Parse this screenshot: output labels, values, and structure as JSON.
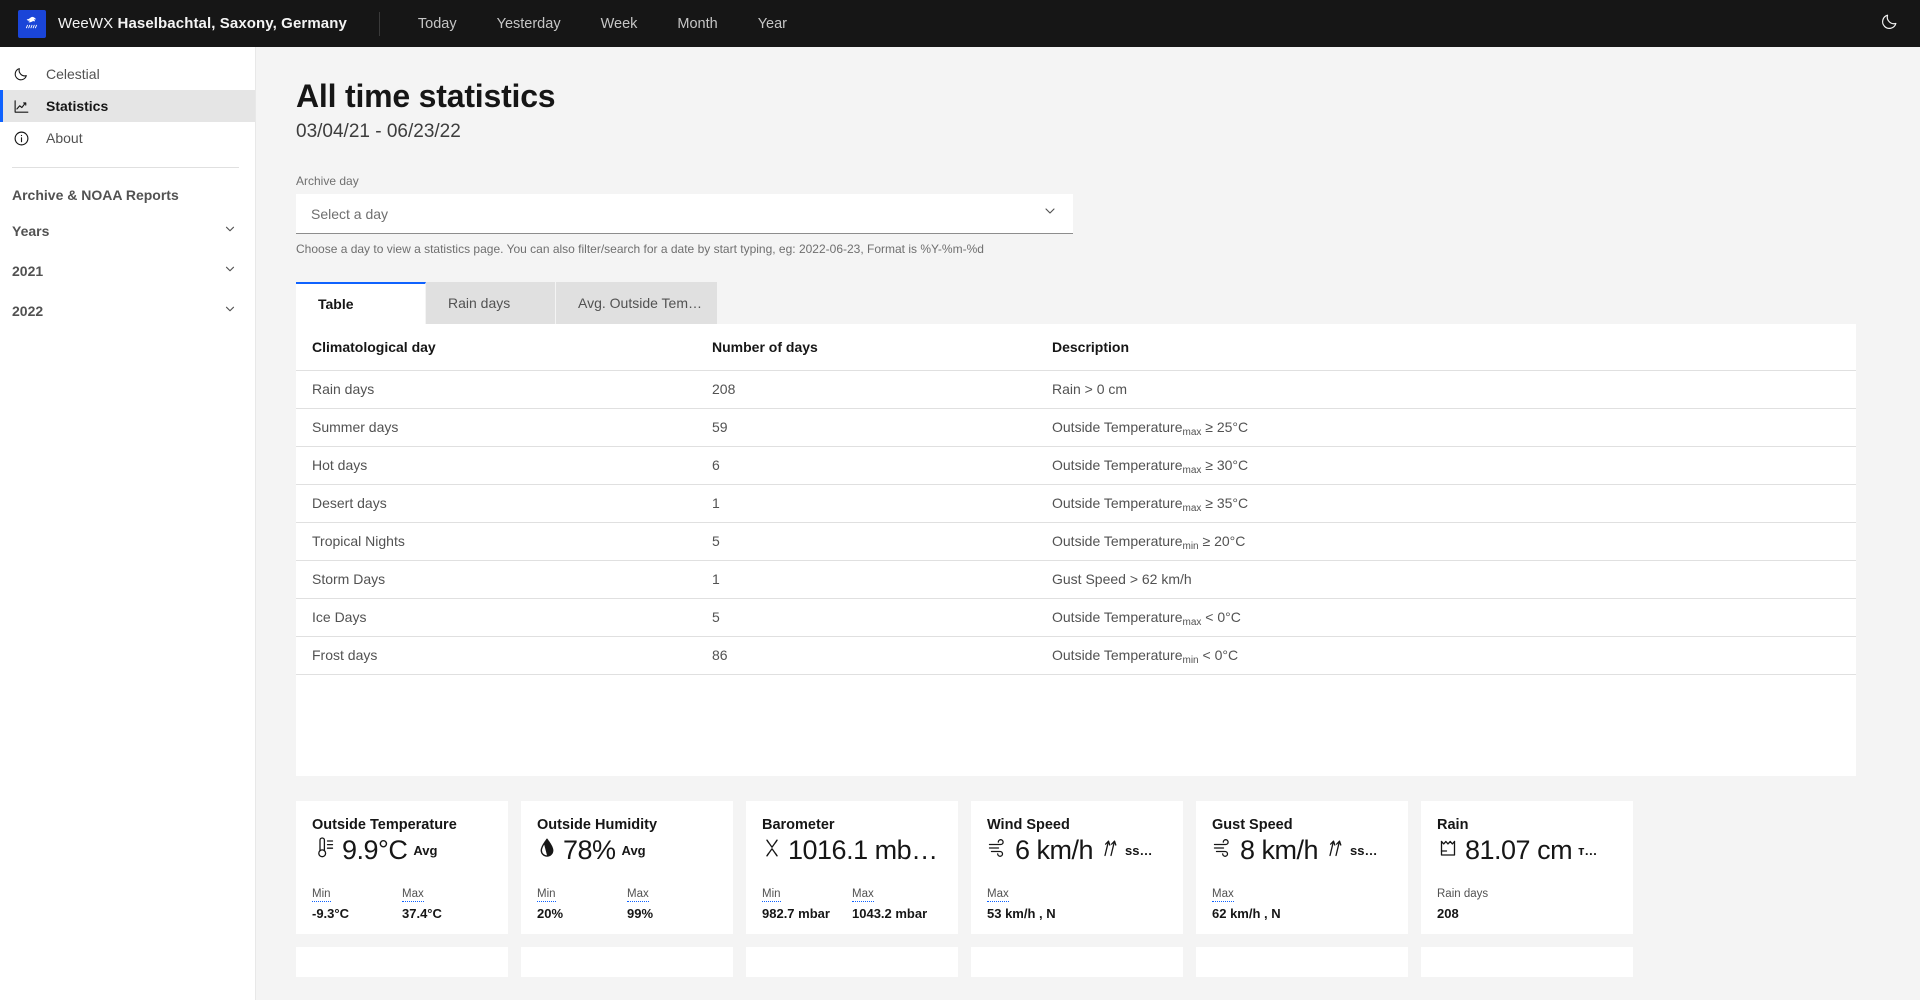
{
  "topbar": {
    "logo_icon": "weewx-logo-icon",
    "app_name": "WeeWX ",
    "station": "Haselbachtal, Saxony, Germany",
    "nav": [
      {
        "label": "Today"
      },
      {
        "label": "Yesterday"
      },
      {
        "label": "Week"
      },
      {
        "label": "Month"
      },
      {
        "label": "Year"
      }
    ],
    "theme_toggle_icon": "moon-icon"
  },
  "sidebar": {
    "items": [
      {
        "label": "Celestial",
        "icon": "moon-icon",
        "active": false
      },
      {
        "label": "Statistics",
        "icon": "chart-line-icon",
        "active": true
      },
      {
        "label": "About",
        "icon": "info-circle-icon",
        "active": false
      }
    ],
    "section_heading": "Archive & NOAA Reports",
    "accordions": [
      {
        "label": "Years",
        "icon": "chevron-down-icon"
      },
      {
        "label": "2021",
        "icon": "chevron-down-icon"
      },
      {
        "label": "2022",
        "icon": "chevron-down-icon"
      }
    ]
  },
  "page": {
    "title": "All time statistics",
    "date_range": "03/04/21 - 06/23/22"
  },
  "archive_day": {
    "label": "Archive day",
    "placeholder": "Select a day",
    "chevron_icon": "chevron-down-icon",
    "helper": "Choose a day to view a statistics page. You can also filter/search for a date by start typing, eg: 2022-06-23, Format is %Y-%m-%d"
  },
  "tabs": [
    {
      "label": "Table",
      "active": true
    },
    {
      "label": "Rain days",
      "active": false
    },
    {
      "label": "Avg. Outside Tem…",
      "active": false
    }
  ],
  "table": {
    "headers": [
      "Climatological day",
      "Number of days",
      "Description"
    ],
    "rows": [
      {
        "day": "Rain days",
        "count": "208",
        "desc_pre": "Rain > 0 cm",
        "desc_sub": "",
        "desc_post": ""
      },
      {
        "day": "Summer days",
        "count": "59",
        "desc_pre": "Outside Temperature",
        "desc_sub": "max",
        "desc_post": " ≥ 25°C"
      },
      {
        "day": "Hot days",
        "count": "6",
        "desc_pre": "Outside Temperature",
        "desc_sub": "max",
        "desc_post": " ≥ 30°C"
      },
      {
        "day": "Desert days",
        "count": "1",
        "desc_pre": "Outside Temperature",
        "desc_sub": "max",
        "desc_post": " ≥ 35°C"
      },
      {
        "day": "Tropical Nights",
        "count": "5",
        "desc_pre": "Outside Temperature",
        "desc_sub": "min",
        "desc_post": " ≥ 20°C"
      },
      {
        "day": "Storm Days",
        "count": "1",
        "desc_pre": "Gust Speed > 62 km/h",
        "desc_sub": "",
        "desc_post": ""
      },
      {
        "day": "Ice Days",
        "count": "5",
        "desc_pre": "Outside Temperature",
        "desc_sub": "max",
        "desc_post": " < 0°C"
      },
      {
        "day": "Frost days",
        "count": "86",
        "desc_pre": "Outside Temperature",
        "desc_sub": "min",
        "desc_post": " < 0°C"
      }
    ]
  },
  "cards": [
    {
      "title": "Outside Temperature",
      "icon": "thermometer-icon",
      "value": "9.9°C",
      "value_suffix": "Avg",
      "footers": [
        {
          "label": "Min",
          "dotted": true,
          "value": "-9.3°C"
        },
        {
          "label": "Max",
          "dotted": true,
          "value": "37.4°C"
        }
      ]
    },
    {
      "title": "Outside Humidity",
      "icon": "humidity-drop-icon",
      "value": "78%",
      "value_suffix": "Avg",
      "footers": [
        {
          "label": "Min",
          "dotted": true,
          "value": "20%"
        },
        {
          "label": "Max",
          "dotted": true,
          "value": "99%"
        }
      ]
    },
    {
      "title": "Barometer",
      "icon": "barometer-icon",
      "value": "1016.1 mb…",
      "value_suffix": "",
      "footers": [
        {
          "label": "Min",
          "dotted": true,
          "value": "982.7 mbar"
        },
        {
          "label": "Max",
          "dotted": true,
          "value": "1043.2 mbar"
        }
      ]
    },
    {
      "title": "Wind Speed",
      "icon": "wind-icon",
      "value": "6 km/h",
      "value_suffix": "ss…",
      "value_suffix_icon": "wind-direction-icon",
      "footers": [
        {
          "label": "Max",
          "dotted": true,
          "value": "53 km/h , N"
        }
      ]
    },
    {
      "title": "Gust Speed",
      "icon": "wind-icon",
      "value": "8 km/h",
      "value_suffix": "ss…",
      "value_suffix_icon": "wind-direction-icon",
      "footers": [
        {
          "label": "Max",
          "dotted": true,
          "value": "62 km/h , N"
        }
      ]
    },
    {
      "title": "Rain",
      "icon": "rain-gauge-icon",
      "value": "81.07 cm",
      "value_suffix": "т…",
      "footers": [
        {
          "label": "Rain days",
          "dotted": false,
          "value": "208"
        }
      ]
    }
  ],
  "colors": {
    "accent": "#0f62fe",
    "topbar_bg": "#161616",
    "page_bg": "#f4f4f4",
    "logo_bg": "#1a45d8"
  }
}
